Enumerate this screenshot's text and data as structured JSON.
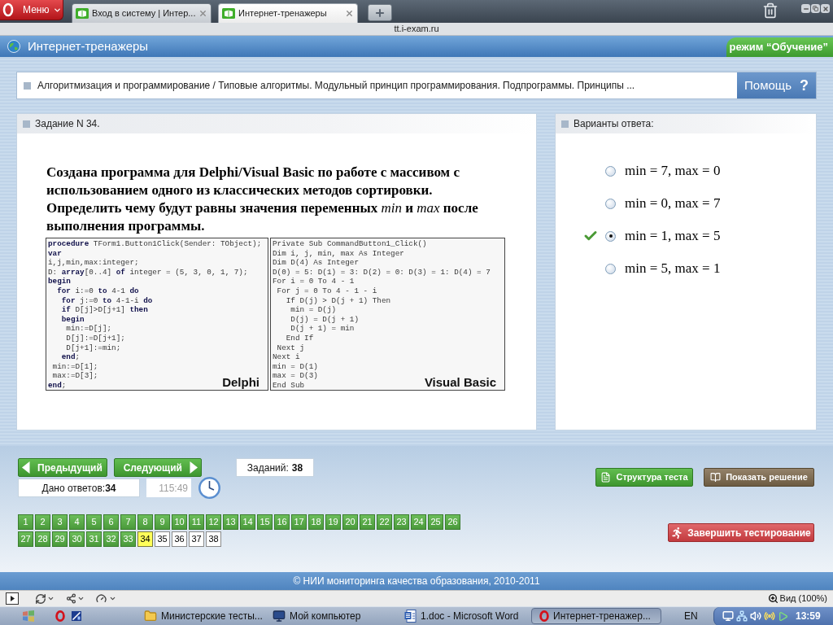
{
  "browser": {
    "menu": "Меню",
    "tabs": [
      {
        "title": "Вход в систему | Интер...",
        "selected": false
      },
      {
        "title": "Интернет-тренажеры",
        "selected": true
      }
    ],
    "address": "tt.i-exam.ru"
  },
  "site_header": {
    "title": "Интернет-тренажеры",
    "mode": "режим “Обучение”"
  },
  "breadcrumb": {
    "text": "Алгоритмизация и программирование / Типовые алгоритмы. Модульный принцип программирования. Подпрограммы. Принципы ...",
    "help_button": "Помощь",
    "help_mark": "?"
  },
  "question": {
    "title": "Задание N 34.",
    "text": "Создана программа для Delphi/Visual Basic по работе с массивом с использованием одного из классических методов сортировки. Определить чему будут равны значения переменных *min* и *max* после выполнения программы.",
    "code_panels": [
      {
        "label": "Delphi",
        "lines": [
          "**procedure** TForm1.Button1Click(Sender: TObject);",
          "**var**",
          "i,j,min,max:integer;",
          "D: **array**[0..4] **of** integer = (5, 3, 0, 1, 7);",
          "**begin**",
          "  **for** i:=0 **to** 4-1 **do**",
          "   **for** j:=0 **to** 4-1-i **do**",
          "   **if** D[j]>D[j+1] **then**",
          "   **begin**",
          "    min:=D[j];",
          "    D[j]:=D[j+1];",
          "    D[j+1]:=min;",
          "   **end**;",
          " min:=D[1];",
          " max:=D[3];",
          "**end**;"
        ]
      },
      {
        "label": "Visual Basic",
        "lines": [
          "Private Sub CommandButton1_Click()",
          "Dim i, j, min, max As Integer",
          "Dim D(4) As Integer",
          "D(0) = 5: D(1) = 3: D(2) = 0: D(3) = 1: D(4) = 7",
          "For i = 0 To 4 - 1",
          " For j = 0 To 4 - 1 - i",
          "   If D(j) > D(j + 1) Then",
          "    min = D(j)",
          "    D(j) = D(j + 1)",
          "    D(j + 1) = min",
          "   End If",
          " Next j",
          "Next i",
          "min = D(1)",
          "max = D(3)",
          "End Sub"
        ]
      }
    ]
  },
  "answers": {
    "title": "Варианты ответа:",
    "options": [
      {
        "text": "min = 7, max = 0",
        "selected": false,
        "confirmed": false
      },
      {
        "text": "min = 0, max = 7",
        "selected": false,
        "confirmed": false
      },
      {
        "text": "min = 1, max = 5",
        "selected": true,
        "confirmed": true
      },
      {
        "text": "min = 5, max = 1",
        "selected": false,
        "confirmed": false
      }
    ]
  },
  "navigation": {
    "previous": "Предыдущий",
    "next": "Следующий",
    "tasks_label": "Заданий:",
    "tasks_total": "38",
    "answered_label": "Дано ответов:",
    "answered_count": "34",
    "timer": "115:49"
  },
  "actions": [
    {
      "label": "Структура теста",
      "kind": "structure"
    },
    {
      "label": "Показать решение",
      "kind": "solution"
    },
    {
      "label": "Завершить тестирование",
      "kind": "finish"
    }
  ],
  "task_grid": [
    {
      "number": "1",
      "answered": true,
      "selected": false
    },
    {
      "number": "2",
      "answered": true,
      "selected": false
    },
    {
      "number": "3",
      "answered": true,
      "selected": false
    },
    {
      "number": "4",
      "answered": true,
      "selected": false
    },
    {
      "number": "5",
      "answered": true,
      "selected": false
    },
    {
      "number": "6",
      "answered": true,
      "selected": false
    },
    {
      "number": "7",
      "answered": true,
      "selected": false
    },
    {
      "number": "8",
      "answered": true,
      "selected": false
    },
    {
      "number": "9",
      "answered": true,
      "selected": false
    },
    {
      "number": "10",
      "answered": true,
      "selected": false
    },
    {
      "number": "11",
      "answered": true,
      "selected": false
    },
    {
      "number": "12",
      "answered": true,
      "selected": false
    },
    {
      "number": "13",
      "answered": true,
      "selected": false
    },
    {
      "number": "14",
      "answered": true,
      "selected": false
    },
    {
      "number": "15",
      "answered": true,
      "selected": false
    },
    {
      "number": "16",
      "answered": true,
      "selected": false
    },
    {
      "number": "17",
      "answered": true,
      "selected": false
    },
    {
      "number": "18",
      "answered": true,
      "selected": false
    },
    {
      "number": "19",
      "answered": true,
      "selected": false
    },
    {
      "number": "20",
      "answered": true,
      "selected": false
    },
    {
      "number": "21",
      "answered": true,
      "selected": false
    },
    {
      "number": "22",
      "answered": true,
      "selected": false
    },
    {
      "number": "23",
      "answered": true,
      "selected": false
    },
    {
      "number": "24",
      "answered": true,
      "selected": false
    },
    {
      "number": "25",
      "answered": true,
      "selected": false
    },
    {
      "number": "26",
      "answered": true,
      "selected": false
    },
    {
      "number": "27",
      "answered": true,
      "selected": false
    },
    {
      "number": "28",
      "answered": true,
      "selected": false
    },
    {
      "number": "29",
      "answered": true,
      "selected": false
    },
    {
      "number": "30",
      "answered": true,
      "selected": false
    },
    {
      "number": "31",
      "answered": true,
      "selected": false
    },
    {
      "number": "32",
      "answered": true,
      "selected": false
    },
    {
      "number": "33",
      "answered": true,
      "selected": false
    },
    {
      "number": "34",
      "answered": true,
      "selected": true
    },
    {
      "number": "35",
      "answered": false,
      "selected": false
    },
    {
      "number": "36",
      "answered": false,
      "selected": false
    },
    {
      "number": "37",
      "answered": false,
      "selected": false
    },
    {
      "number": "38",
      "answered": false,
      "selected": false
    }
  ],
  "footer": "© НИИ мониторинга качества образования, 2010-2011",
  "status_bar": {
    "zoom": "Вид (100%)"
  },
  "taskbar": {
    "tasks": [
      {
        "label": "Министерские тесты...",
        "kind": "folder",
        "selected": false
      },
      {
        "label": "Мой компьютер",
        "kind": "computer",
        "selected": false
      },
      {
        "label": "1.doc - Microsoft Word",
        "kind": "word",
        "selected": false
      },
      {
        "label": "Интернет-тренажер...",
        "kind": "opera",
        "selected": true
      }
    ],
    "language": "EN",
    "clock": "13:59"
  }
}
